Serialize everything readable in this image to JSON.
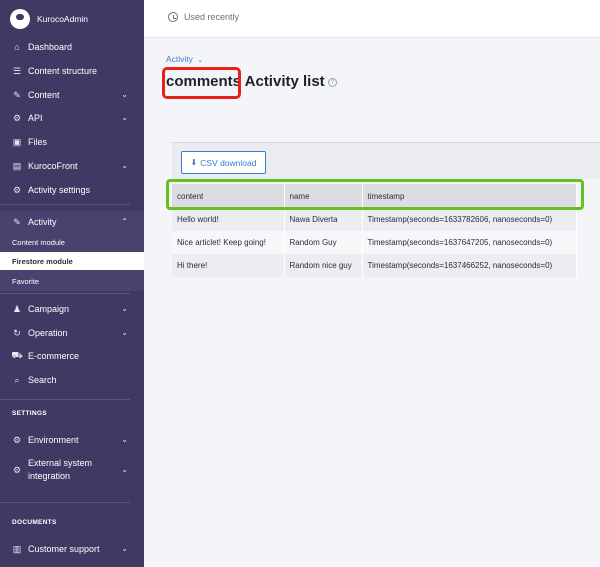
{
  "sidebar": {
    "brand": "KurocoAdmin",
    "items": [
      {
        "label": "Dashboard",
        "icon": "home-icon"
      },
      {
        "label": "Content structure",
        "icon": "database-icon"
      },
      {
        "label": "Content",
        "icon": "edit-icon"
      },
      {
        "label": "API",
        "icon": "api-icon"
      },
      {
        "label": "Files",
        "icon": "image-icon"
      },
      {
        "label": "KurocoFront",
        "icon": "front-icon"
      },
      {
        "label": "Activity settings",
        "icon": "gear-icon"
      },
      {
        "label": "Activity",
        "icon": "edit-icon"
      }
    ],
    "activity_sub": [
      "Content module",
      "Firestore module",
      "Favorite"
    ],
    "items2": [
      {
        "label": "Campaign",
        "icon": "person-icon"
      },
      {
        "label": "Operation",
        "icon": "refresh-icon"
      },
      {
        "label": "E-commerce",
        "icon": "cart-icon"
      },
      {
        "label": "Search",
        "icon": "search-icon"
      }
    ],
    "settings_label": "SETTINGS",
    "environment": "Environment",
    "external": "External system integration",
    "documents_label": "DOCUMENTS",
    "customer_support": "Customer support"
  },
  "topbar": {
    "recent": "Used recently"
  },
  "breadcrumb": "Activity",
  "title": {
    "highlight": "comments",
    "rest": " Activity list"
  },
  "csv_button": "CSV download",
  "table": {
    "headers": [
      "content",
      "name",
      "timestamp"
    ],
    "rows": [
      [
        "Hello world!",
        "Nawa Diverta",
        "Timestamp(seconds=1633782606, nanoseconds=0)"
      ],
      [
        "Nice articlet! Keep going!",
        "Random Guy",
        "Timestamp(seconds=1637647205, nanoseconds=0)"
      ],
      [
        "Hi there!",
        "Random nice guy",
        "Timestamp(seconds=1637466252, nanoseconds=0)"
      ]
    ]
  },
  "colors": {
    "sidebar": "#3f3a63",
    "accent": "#3a7bd5",
    "highlight_red": "#e8201a",
    "highlight_green": "#66c022"
  }
}
